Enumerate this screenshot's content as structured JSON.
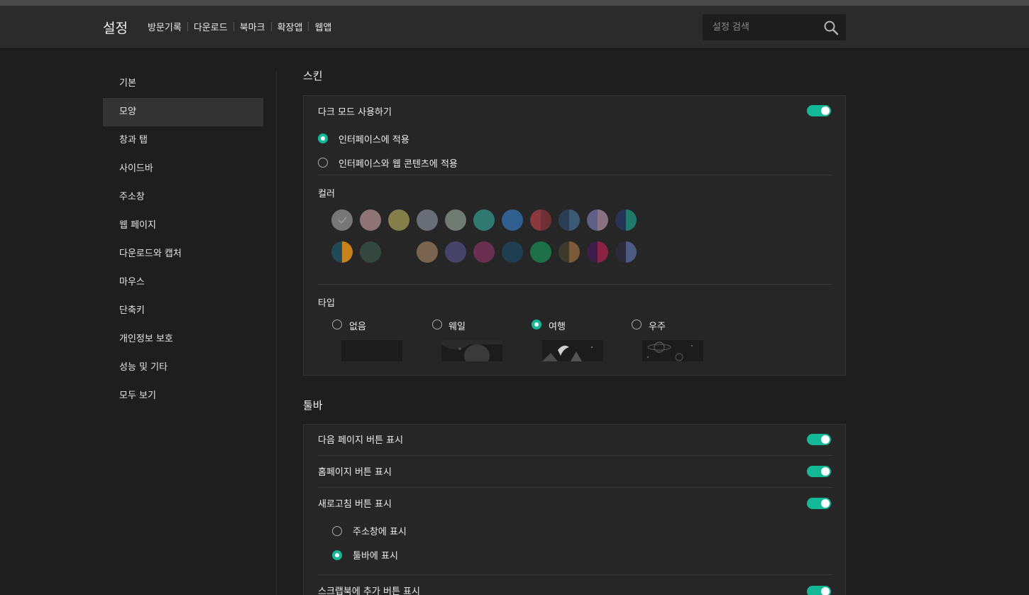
{
  "header": {
    "title": "설정",
    "nav": [
      "방문기록",
      "다운로드",
      "북마크",
      "확장앱",
      "웹앱"
    ],
    "search_placeholder": "설정 검색"
  },
  "sidebar": {
    "items": [
      "기본",
      "모양",
      "창과 탭",
      "사이드바",
      "주소창",
      "웹 페이지",
      "다운로드와 캡처",
      "마우스",
      "단축키",
      "개인정보 보호",
      "성능 및 기타",
      "모두 보기"
    ],
    "active_index": 1
  },
  "skin": {
    "title": "스킨",
    "dark_mode_label": "다크 모드 사용하기",
    "dark_mode_on": true,
    "apply_options": [
      "인터페이스에 적용",
      "인터페이스와 웹 콘텐츠에 적용"
    ],
    "apply_selected": 0,
    "color_label": "컬러",
    "colors_row1": [
      [
        "#777777",
        "#777777"
      ],
      [
        "#8e7474",
        "#8e7474"
      ],
      [
        "#85804a",
        "#85804a"
      ],
      [
        "#6a6e78",
        "#6a6e78"
      ],
      [
        "#6e7a72",
        "#6e7a72"
      ],
      [
        "#2f7a70",
        "#2f7a70"
      ],
      [
        "#2e5f8f",
        "#2e5f8f"
      ],
      [
        "#8a3a3f",
        "#6e3035"
      ],
      [
        "#2a3f55",
        "#3d5a74"
      ],
      [
        "#5e6088",
        "#8a7282"
      ],
      [
        "#273458",
        "#1f7a6c"
      ]
    ],
    "colors_row2": [
      [
        "#1f4b58",
        "#c8821e"
      ],
      [
        "#34483f",
        "#34483f"
      ],
      [
        "#262626",
        "#262626"
      ],
      [
        "#7a6450",
        "#7a6450"
      ],
      [
        "#474268",
        "#474268"
      ],
      [
        "#6a2f50",
        "#6a2f50"
      ],
      [
        "#203e52",
        "#203e52"
      ],
      [
        "#1d7048",
        "#1d7048"
      ],
      [
        "#3c3a2a",
        "#7a5a38"
      ],
      [
        "#3e1d4a",
        "#8a2244"
      ],
      [
        "#2a2a38",
        "#4c5a84"
      ]
    ],
    "selected_color": 0,
    "type_label": "타입",
    "types": [
      "없음",
      "웨일",
      "여행",
      "우주"
    ],
    "type_selected": 2
  },
  "toolbar": {
    "title": "툴바",
    "rows": [
      {
        "label": "다음 페이지 버튼 표시",
        "on": true
      },
      {
        "label": "홈페이지 버튼 표시",
        "on": true
      },
      {
        "label": "새로고침 버튼 표시",
        "on": true
      }
    ],
    "refresh_options": [
      "주소창에 표시",
      "툴바에 표시"
    ],
    "refresh_selected": 1,
    "scrapbook_label": "스크랩북에 추가 버튼 표시",
    "scrapbook_on": true
  },
  "colors": {
    "accent": "#13b896",
    "background": "#1e1e1f",
    "header": "#2b2b2b",
    "card": "#262626"
  }
}
